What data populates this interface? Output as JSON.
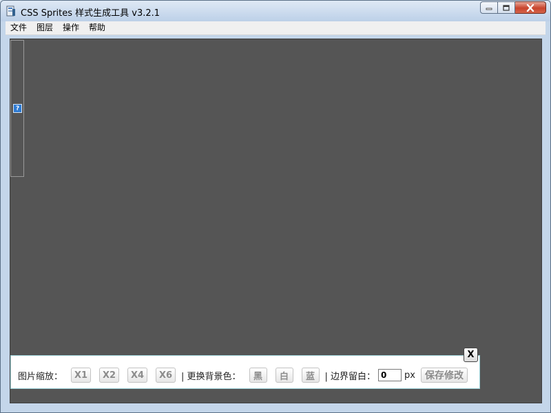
{
  "window": {
    "title": "CSS Sprites 样式生成工具 v3.2.1"
  },
  "menu": {
    "items": [
      "文件",
      "图层",
      "操作",
      "帮助"
    ]
  },
  "side_panel": {
    "help_badge": "?"
  },
  "toolbar": {
    "zoom_label": "图片缩放：",
    "zoom_buttons": [
      "X1",
      "X2",
      "X4",
      "X6"
    ],
    "bg_label": "| 更换背景色：",
    "bg_buttons": [
      "黑",
      "白",
      "蓝"
    ],
    "margin_label": "| 边界留白：",
    "margin_value": "0",
    "margin_unit": "px",
    "save_label": "保存修改",
    "close_label": "X"
  },
  "colors": {
    "canvas_background": "#555555",
    "toolbar_border": "#9fd6dc",
    "help_badge": "#2e7ad1",
    "close_button": "#c8442d"
  },
  "icons": {
    "app": "app-icon",
    "minimize": "minimize-icon",
    "maximize": "maximize-icon",
    "close": "close-icon"
  }
}
